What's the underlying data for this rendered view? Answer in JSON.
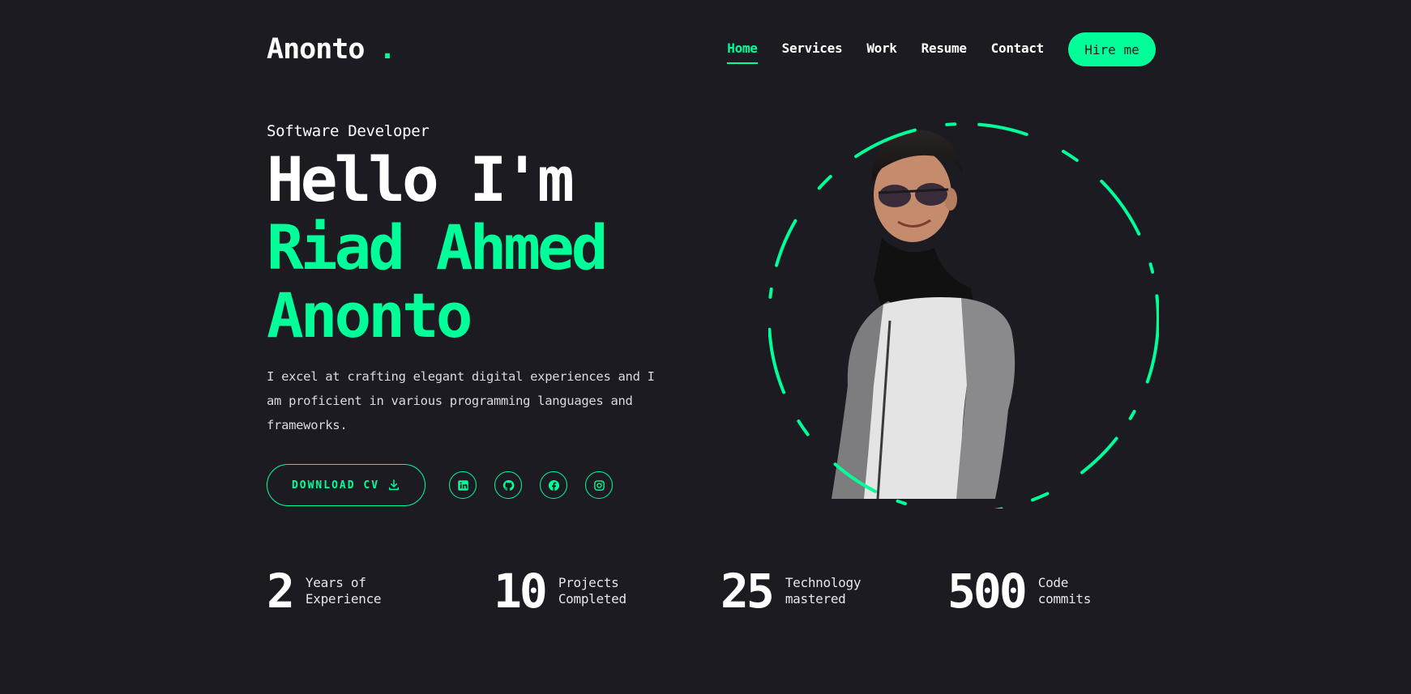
{
  "brand": {
    "name": "Anonto",
    "dot": "."
  },
  "nav": {
    "items": [
      {
        "label": "Home",
        "active": true
      },
      {
        "label": "Services",
        "active": false
      },
      {
        "label": "Work",
        "active": false
      },
      {
        "label": "Resume",
        "active": false
      },
      {
        "label": "Contact",
        "active": false
      }
    ],
    "hire_label": "Hire me"
  },
  "hero": {
    "role": "Software Developer",
    "greeting": "Hello I'm",
    "name_line1": "Riad Ahmed",
    "name_line2": "Anonto",
    "intro": "I excel at crafting elegant digital experiences and I am proficient in various programming languages and frameworks.",
    "cv_label": "DOWNLOAD CV"
  },
  "socials": [
    {
      "icon": "linkedin-icon"
    },
    {
      "icon": "github-icon"
    },
    {
      "icon": "facebook-icon"
    },
    {
      "icon": "instagram-icon"
    }
  ],
  "stats": [
    {
      "value": "2",
      "label": "Years of Experience"
    },
    {
      "value": "10",
      "label": "Projects Completed"
    },
    {
      "value": "25",
      "label": "Technology mastered"
    },
    {
      "value": "500",
      "label": "Code commits"
    }
  ],
  "colors": {
    "accent": "#00ff99",
    "background": "#1c1b22",
    "text": "#ffffff"
  }
}
